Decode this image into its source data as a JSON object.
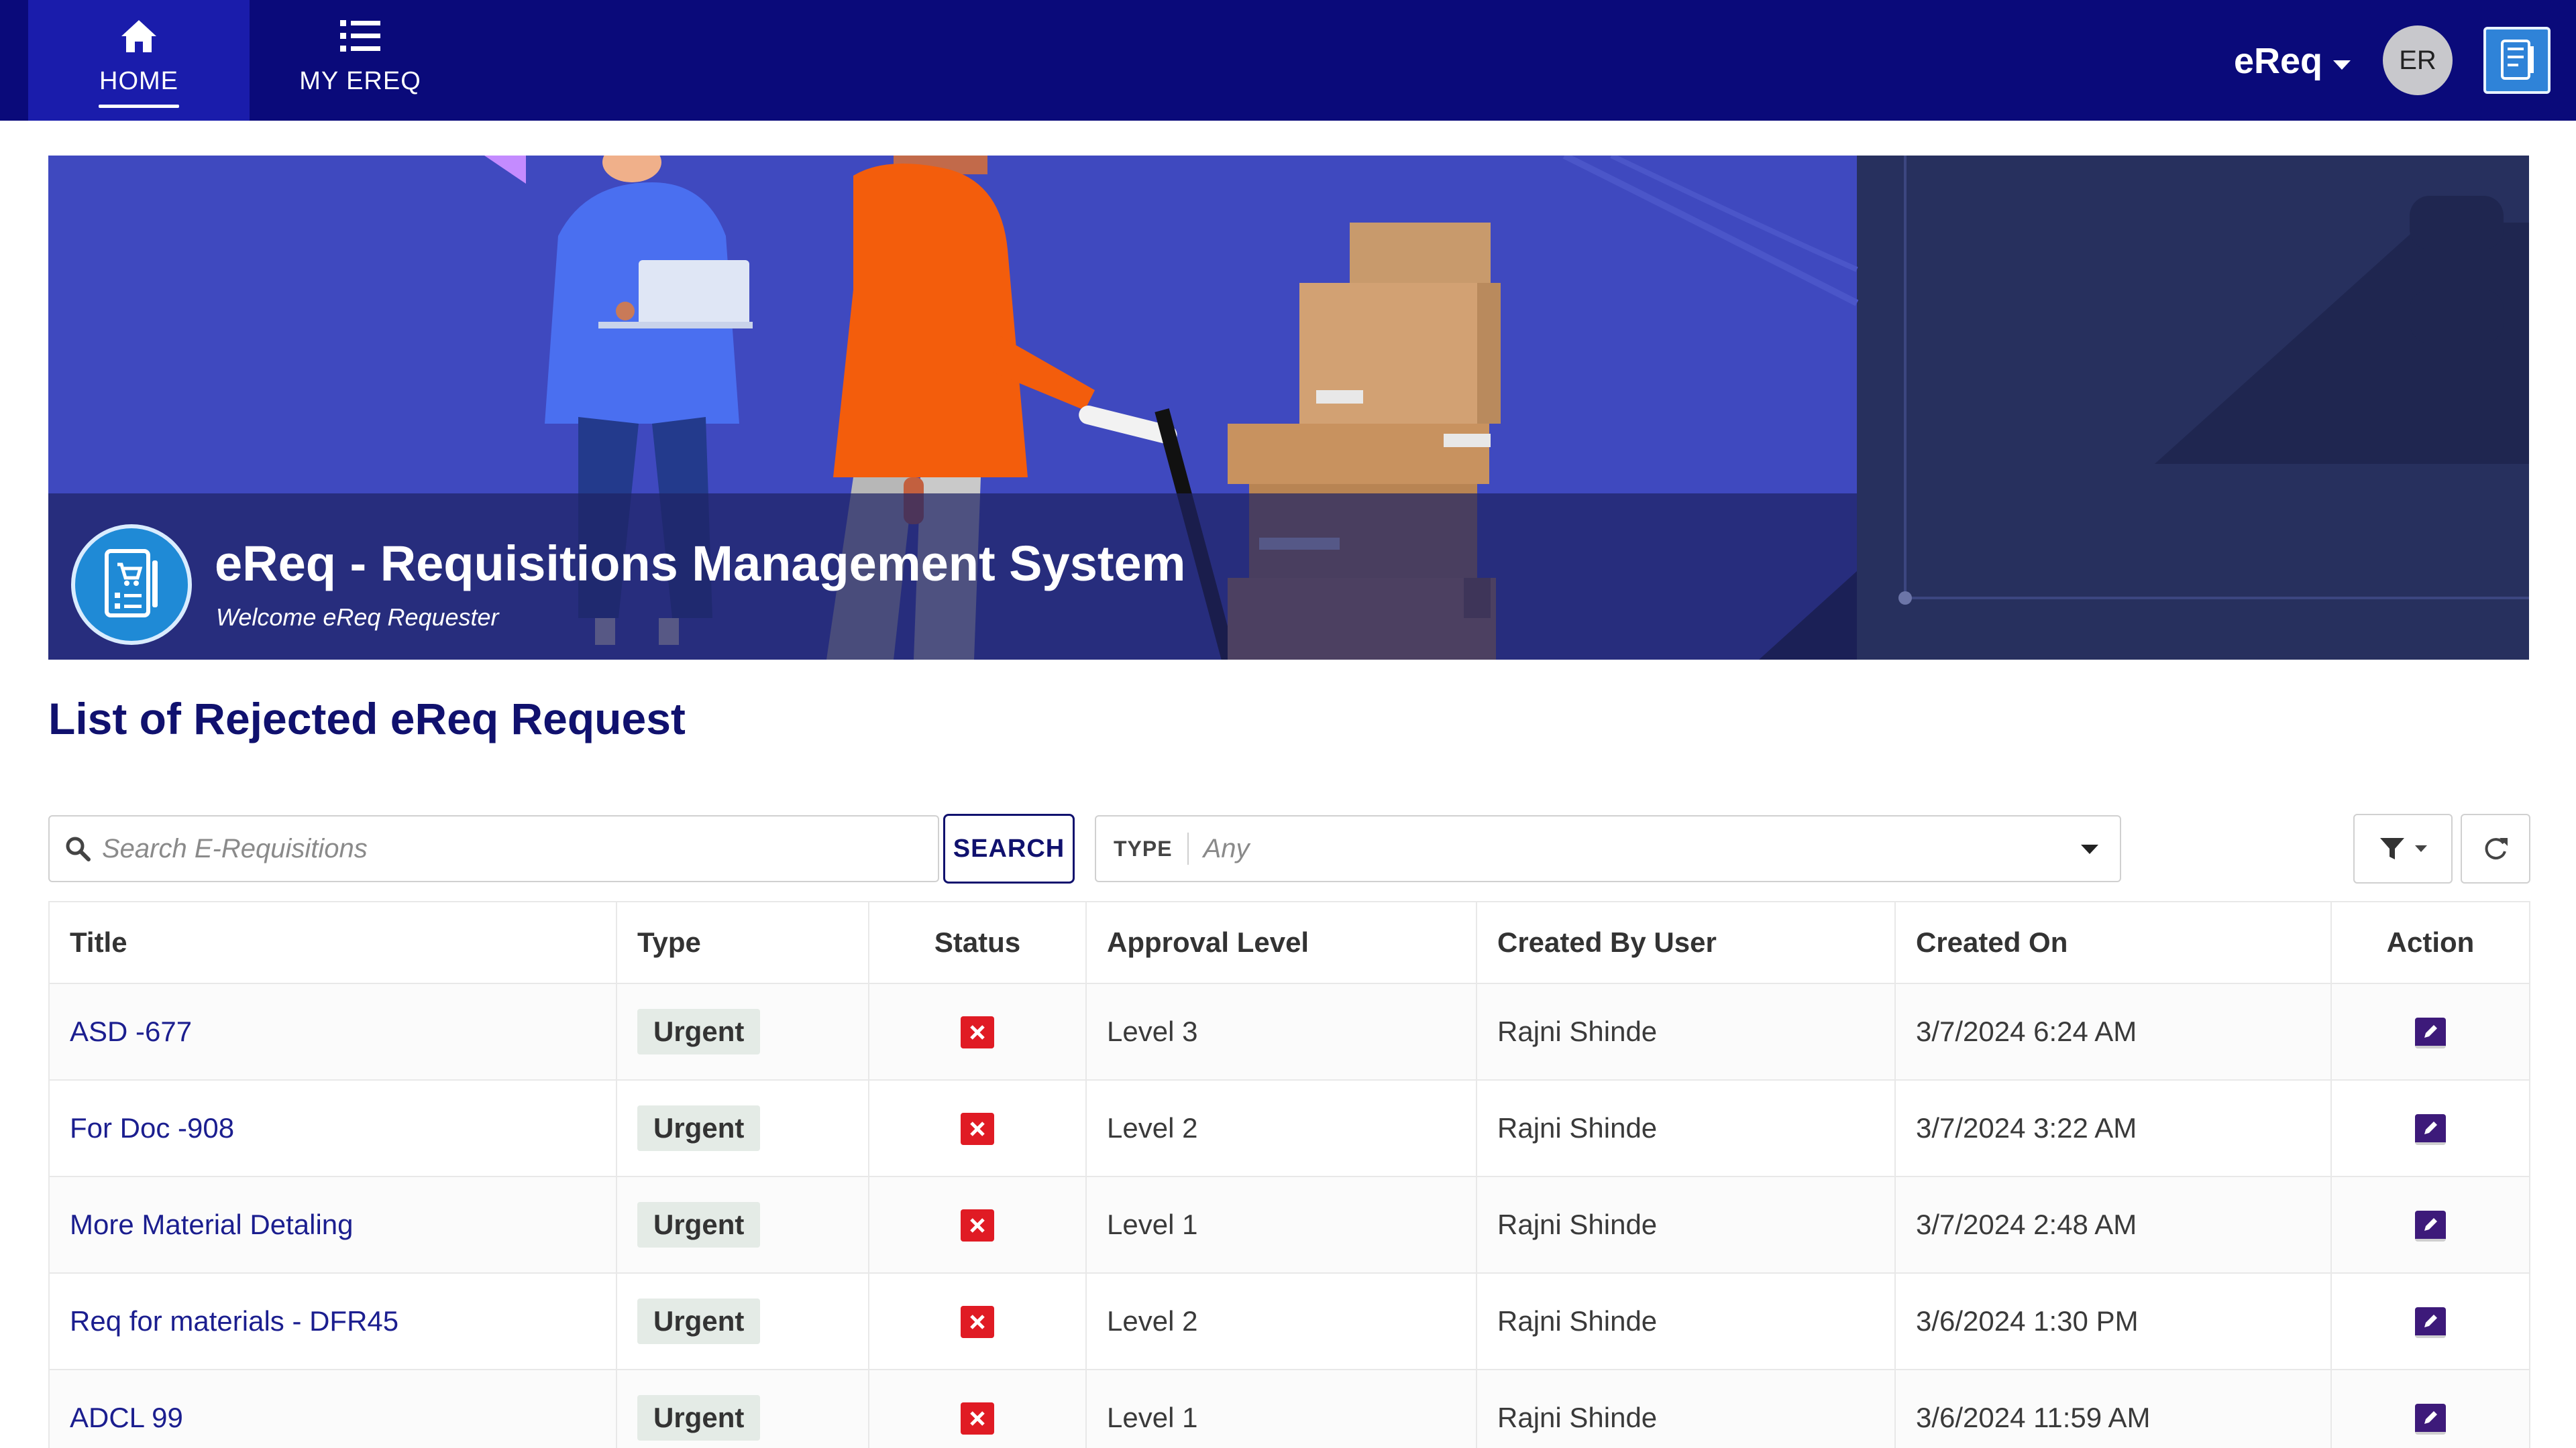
{
  "nav": {
    "items": [
      {
        "label": "HOME",
        "icon": "home-icon",
        "active": true
      },
      {
        "label": "MY EREQ",
        "icon": "list-icon",
        "active": false
      }
    ],
    "app_switcher": "eReq",
    "avatar_initials": "ER"
  },
  "banner": {
    "title": "eReq - Requisitions Management System",
    "subtitle": "Welcome eReq Requester"
  },
  "page_title": "List of Rejected eReq Request",
  "toolbar": {
    "search_placeholder": "Search E-Requisitions",
    "search_button": "SEARCH",
    "type_label": "TYPE",
    "type_value": "Any"
  },
  "table": {
    "columns": [
      "Title",
      "Type",
      "Status",
      "Approval Level",
      "Created By User",
      "Created On",
      "Action"
    ],
    "rows": [
      {
        "title": "ASD -677",
        "type": "Urgent",
        "status": "rejected",
        "approval_level": "Level 3",
        "created_by": "Rajni Shinde",
        "created_on": "3/7/2024 6:24 AM"
      },
      {
        "title": "For Doc -908",
        "type": "Urgent",
        "status": "rejected",
        "approval_level": "Level 2",
        "created_by": "Rajni Shinde",
        "created_on": "3/7/2024 3:22 AM"
      },
      {
        "title": "More Material Detaling",
        "type": "Urgent",
        "status": "rejected",
        "approval_level": "Level 1",
        "created_by": "Rajni Shinde",
        "created_on": "3/7/2024 2:48 AM"
      },
      {
        "title": "Req for materials - DFR45",
        "type": "Urgent",
        "status": "rejected",
        "approval_level": "Level 2",
        "created_by": "Rajni Shinde",
        "created_on": "3/6/2024 1:30 PM"
      },
      {
        "title": "ADCL 99",
        "type": "Urgent",
        "status": "rejected",
        "approval_level": "Level 1",
        "created_by": "Rajni Shinde",
        "created_on": "3/6/2024 11:59 AM"
      }
    ]
  },
  "colors": {
    "nav_bg": "#0a0a7a",
    "nav_active": "#1a1cab",
    "banner_bg": "#3f49bf",
    "heading": "#10116e",
    "link": "#1b1e8f",
    "status_rejected": "#e01b24",
    "edit_action": "#3d1a7a"
  }
}
